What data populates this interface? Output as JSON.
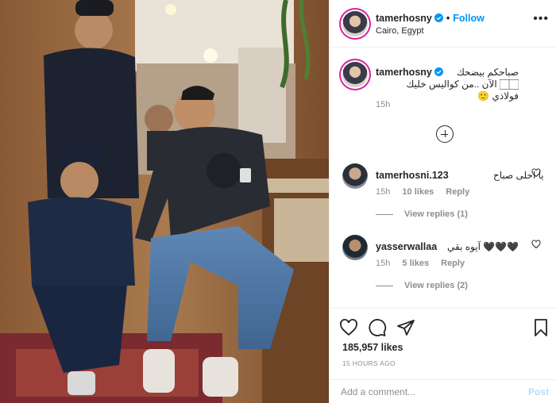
{
  "post": {
    "author": "tamerhosny",
    "follow_label": "Follow",
    "separator": "•",
    "location": "Cairo, Egypt",
    "more_label": "•••",
    "caption": "صباحكم بيضحك\n🏻🏻 الآن ..من كواليس خليك فولاذي 🙂",
    "caption_time": "15h"
  },
  "comments": [
    {
      "username": "tamerhosni.123",
      "text": "يا احلى صباح",
      "time": "15h",
      "likes": "10 likes",
      "reply_label": "Reply",
      "view_replies": "View replies (1)"
    },
    {
      "username": "yasserwallaa",
      "text": "آيوه بقي 🖤🖤🖤",
      "time": "15h",
      "likes": "5 likes",
      "reply_label": "Reply",
      "view_replies": "View replies (2)"
    }
  ],
  "footer": {
    "likes": "185,957 likes",
    "posted_ago": "15 HOURS AGO",
    "comment_placeholder": "Add a comment...",
    "post_label": "Post"
  },
  "icons": {
    "verified": "verified-badge-icon",
    "like": "heart-icon",
    "comment": "comment-icon",
    "share": "paper-plane-icon",
    "save": "bookmark-icon",
    "load_more": "plus-circle-icon"
  },
  "colors": {
    "link_blue": "#0095f6",
    "post_disabled": "#b2dffc",
    "muted": "#8e8e8e",
    "text": "#262626"
  }
}
